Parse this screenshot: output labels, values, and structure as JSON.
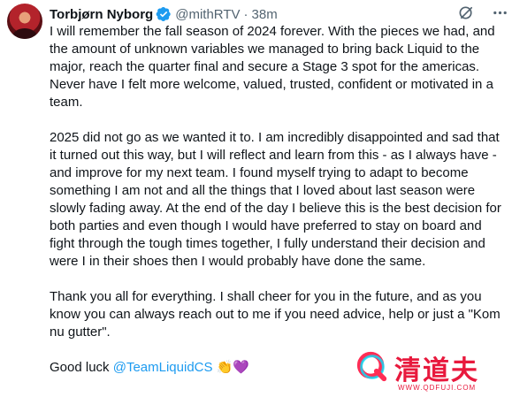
{
  "tweet": {
    "author_name": "Torbjørn Nyborg",
    "handle": "@mithRTV",
    "separator": "·",
    "time": "38m",
    "paragraphs": [
      "I will remember the fall season of 2024 forever. With the pieces we had, and the amount of unknown variables we managed to bring back Liquid to the major, reach the quarter final and secure a Stage 3 spot for the americas. Never have I felt more welcome, valued, trusted, confident or motivated in a team.",
      "2025 did not go as we wanted it to. I am incredibly disappointed and sad that it turned out this way, but I will reflect and learn from this - as I always have - and improve for my next team. I found myself trying to adapt to become something I am not and all the things that I loved about last season were slowly fading away. At the end of the day I believe this is the best decision for both parties and even though I would have preferred to stay on board and fight through the tough times together, I fully understand their decision and were I in their shoes then I would probably have done the same.",
      "Thank you all for everything. I shall cheer for you in the future, and as you know you can always reach out to me if you need advice, help or just a \"Kom nu gutter\"."
    ],
    "closing_text": "Good luck ",
    "mention": "@TeamLiquidCS",
    "emojis": "👏💜"
  },
  "watermark": {
    "text": "清道夫",
    "url": "WWW.QDFUJI.COM"
  },
  "colors": {
    "text": "#0f1419",
    "secondary": "#536471",
    "link": "#1d9bf0",
    "verified": "#1d9bf0",
    "watermark": "#e8193d"
  },
  "icons": [
    "verified-badge-icon",
    "grok-icon",
    "more-icon"
  ]
}
